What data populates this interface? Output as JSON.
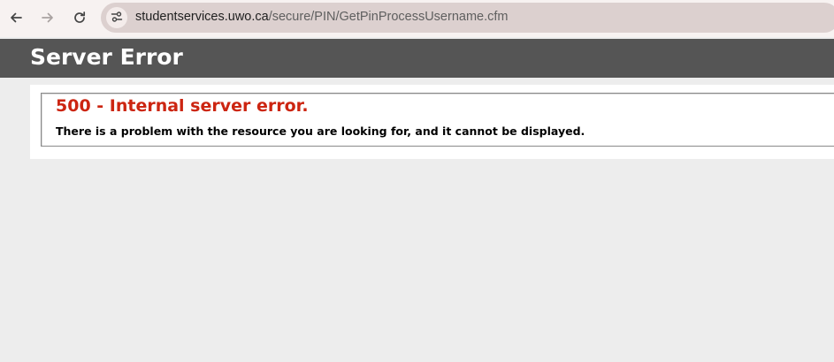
{
  "browser": {
    "url_host": "studentservices.uwo.ca",
    "url_path": "/secure/PIN/GetPinProcessUsername.cfm",
    "icons": {
      "back": "back-arrow-icon",
      "forward": "forward-arrow-icon",
      "reload": "reload-icon",
      "site_info": "tune-icon"
    }
  },
  "page": {
    "header_title": "Server Error",
    "error_heading": "500 - Internal server error.",
    "error_message": "There is a problem with the resource you are looking for, and it cannot be displayed."
  },
  "colors": {
    "header_bg": "#555555",
    "error_red": "#cc2511",
    "page_bg": "#ededed",
    "toolbar_bg": "#f7f2f1",
    "omnibox_bg": "#dcd0cf"
  }
}
